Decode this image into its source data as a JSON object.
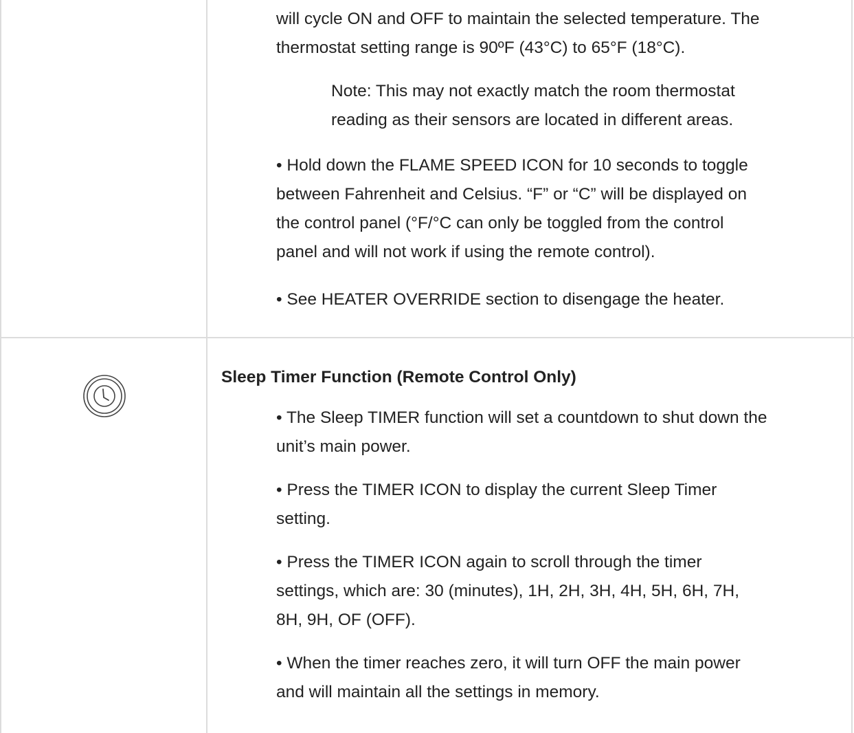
{
  "row_top": {
    "paragraphs": [
      "will cycle ON and OFF to maintain the selected temperature. The\nthermostat setting range is 90ºF (43°C) to 65°F (18°C).",
      "• Hold down the FLAME SPEED ICON for 10 seconds to toggle\nbetween Fahrenheit and Celsius. “F” or “C” will be displayed on\nthe control panel (°F/°C can only be toggled from the control\npanel and will not work if using the remote control).",
      "• See HEATER OVERRIDE section to disengage the heater."
    ],
    "note": "Note: This may not exactly match the room thermostat\nreading as their sensors are located in different areas."
  },
  "row_timer": {
    "icon": "clock-icon",
    "heading": "Sleep Timer Function (Remote Control Only)",
    "bullets": [
      "• The Sleep TIMER function will set a countdown to shut down the\nunit’s main power.",
      "• Press the TIMER ICON to display the current Sleep Timer\nsetting.",
      "• Press the TIMER ICON again to scroll through the timer\nsettings, which are: 30 (minutes), 1H, 2H, 3H, 4H, 5H, 6H, 7H,\n8H, 9H, OF (OFF).",
      "• When the timer reaches zero, it will turn OFF the main power\nand will maintain all the settings in memory."
    ]
  }
}
